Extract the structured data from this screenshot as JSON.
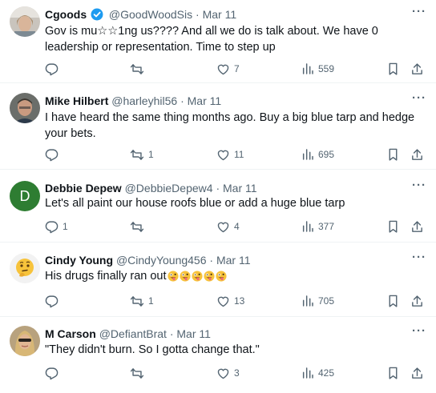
{
  "colors": {
    "text": "#0f1419",
    "secondary": "#536471",
    "verified": "#1d9bf0",
    "divider": "#eff3f4",
    "avatar_d": "#2e7d32"
  },
  "tweets": [
    {
      "name": "Cgoods",
      "handle": "@GoodWoodSis",
      "time": "· Mar 11",
      "verified": true,
      "text": "Gov is mu☆☆1ng us???? And all we do is talk about. We have 0 leadership or representation. Time to step up",
      "replies": "",
      "reposts": "",
      "likes": "7",
      "views": "559"
    },
    {
      "name": "Mike Hilbert",
      "handle": "@harleyhil56",
      "time": "· Mar 11",
      "text": "I have heard the same thing months ago. Buy a big blue tarp and hedge your bets.",
      "replies": "",
      "reposts": "1",
      "likes": "11",
      "views": "695"
    },
    {
      "name": "Debbie Depew",
      "handle": "@DebbieDepew4",
      "time": "· Mar 11",
      "avatar_letter": "D",
      "text": "Let's all paint our house roofs blue or add a huge blue tarp",
      "replies": "1",
      "reposts": "",
      "likes": "4",
      "views": "377"
    },
    {
      "name": "Cindy Young",
      "handle": "@CindyYoung456",
      "time": "· Mar 11",
      "text": "His drugs finally ran out",
      "emoji_count": 5,
      "replies": "",
      "reposts": "1",
      "likes": "13",
      "views": "705"
    },
    {
      "name": "M Carson",
      "handle": "@DefiantBrat",
      "time": "· Mar 11",
      "text": "\"They didn't burn. So I gotta change that.\"",
      "replies": "",
      "reposts": "",
      "likes": "3",
      "views": "425"
    }
  ],
  "more_label": "···"
}
